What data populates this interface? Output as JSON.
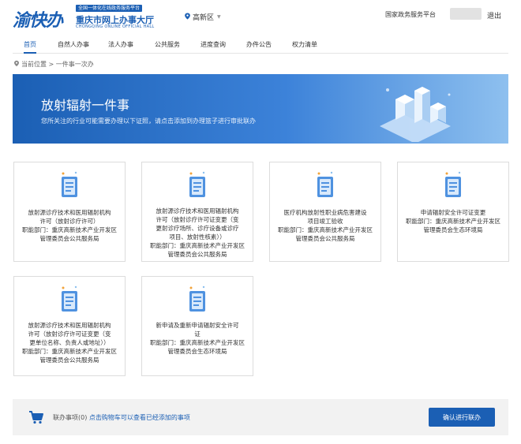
{
  "header": {
    "logo_mark": "渝快办",
    "logo_tag": "全国一体化在线政务服务平台",
    "logo_title": "重庆市网上办事大厅",
    "logo_subtitle": "CHONGQING ONLINE OFFICIAL HALL",
    "location": "高新区",
    "platform_link": "国家政务服务平台",
    "logout": "退出"
  },
  "nav": {
    "items": [
      {
        "label": "首页",
        "active": true
      },
      {
        "label": "自然人办事"
      },
      {
        "label": "法人办事"
      },
      {
        "label": "公共服务"
      },
      {
        "label": "进度查询"
      },
      {
        "label": "办件公告"
      },
      {
        "label": "权力清单"
      }
    ]
  },
  "breadcrumb": {
    "text": "当前位置 > 一件事一次办"
  },
  "banner": {
    "title": "放射辐射一件事",
    "description": "您所关注的行业可能需要办理以下证照，请点击添加到办理篮子进行审批联办"
  },
  "cards": [
    {
      "lines": [
        "放射源诊疗技术和医用辐射机构",
        "许可（放射诊疗许可）",
        "职能部门：重庆高新技术产业开发区",
        "管理委员会公共服务局"
      ]
    },
    {
      "lines": [
        "放射源诊疗技术和医用辐射机构",
        "许可（放射诊疗许可证变更（变",
        "更射诊疗场所、诊疗设备或诊疗",
        "项目、放射性核素））",
        "职能部门：重庆高新技术产业开发区",
        "管理委员会公共服务局"
      ]
    },
    {
      "lines": [
        "医疗机构放射性职业病危害建设",
        "项目竣工验收",
        "职能部门：重庆高新技术产业开发区",
        "管理委员会公共服务局"
      ]
    },
    {
      "lines": [
        "申请辐射安全许可证变更",
        "职能部门：重庆高新技术产业开发区",
        "管理委员会生态环境局"
      ]
    },
    {
      "lines": [
        "放射源诊疗技术和医用辐射机构",
        "许可（放射诊疗许可证变更（变",
        "更单位名称、负责人或地址））",
        "职能部门：重庆高新技术产业开发区",
        "管理委员会公共服务局"
      ]
    },
    {
      "lines": [
        "新申请及重新申请辐射安全许可",
        "证",
        "职能部门：重庆高新技术产业开发区",
        "管理委员会生态环境局"
      ]
    }
  ],
  "footer": {
    "cart_label": "联办事项(0)",
    "cart_link": "点击购物车可以查看已经添加的事项",
    "confirm_button": "确认进行联办"
  }
}
